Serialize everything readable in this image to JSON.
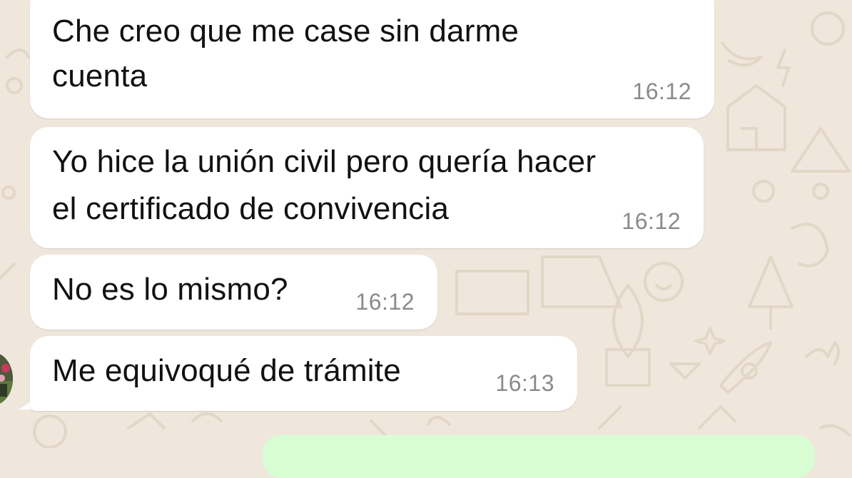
{
  "chat": {
    "messages": [
      {
        "lines": [
          "Che creo que me case sin darme",
          "cuenta"
        ],
        "time": "16:12"
      },
      {
        "lines": [
          "Yo hice la unión civil pero quería hacer",
          "el certificado de convivencia"
        ],
        "time": "16:12"
      },
      {
        "lines": [
          "No es lo mismo?"
        ],
        "time": "16:12"
      },
      {
        "lines": [
          "Me equivoqué de trámite"
        ],
        "time": "16:13"
      }
    ]
  },
  "colors": {
    "wallpaper": "#efe7dc",
    "incoming_bubble": "#ffffff",
    "outgoing_bubble": "#d9fdd3",
    "timestamp": "#8a8a8a",
    "sender_name": "#9c1d59"
  }
}
